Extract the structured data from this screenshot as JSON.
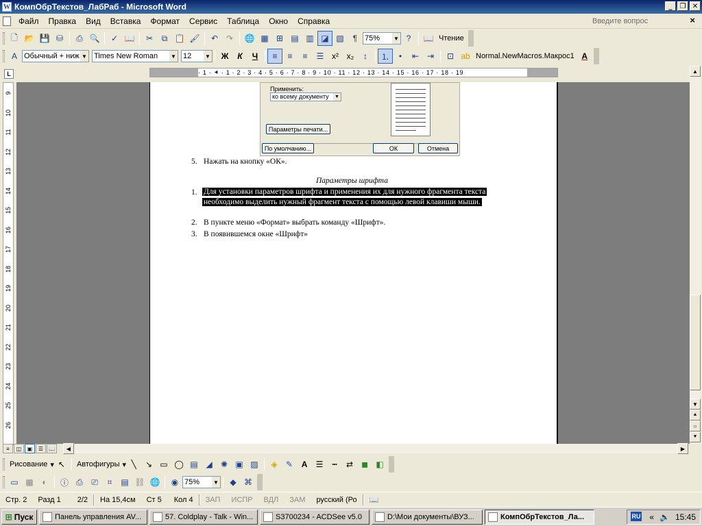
{
  "window": {
    "title": "КомпОбрТекстов_ЛабРаб - Microsoft Word"
  },
  "menu": {
    "items": [
      "Файл",
      "Правка",
      "Вид",
      "Вставка",
      "Формат",
      "Сервис",
      "Таблица",
      "Окно",
      "Справка"
    ],
    "ask_placeholder": "Введите вопрос"
  },
  "toolbar_standard": {
    "zoom": "75%",
    "read_label": "Чтение"
  },
  "toolbar_format": {
    "style": "Обычный + ниж",
    "font": "Times New Roman",
    "size": "12",
    "bold": "Ж",
    "italic": "К",
    "underline": "Ч",
    "macro": "Normal.NewMacros.Макрос1"
  },
  "ruler_marks": "· 1 · ⯇ · 1 · 2 · 3 · 4 · 5 · 6 · 7 · 8 · 9 · 10 · 11 · 12 · 13 · 14 · 15 · 16 · 17 · 18 · 19",
  "dialog": {
    "apply_label": "Применить:",
    "apply_value": "ко всему документу",
    "print_params": "Параметры печати...",
    "default": "По умолчанию...",
    "ok": "ОК",
    "cancel": "Отмена"
  },
  "document": {
    "step5_num": "5.",
    "step5": "Нажать на кнопку «ОК».",
    "heading": "Параметры шрифта",
    "item1_num": "1.",
    "item1_line1": "Для установки параметров шрифта и применения их для нужного фрагмента текста",
    "item1_line2": "необходимо выделить нужный фрагмент текста с помощью левой клавиши мыши.",
    "item2_num": "2.",
    "item2": "В пункте меню «Формат» выбрать команду «Шрифт».",
    "item3_num": "3.",
    "item3": "В появившемся окне «Шрифт»"
  },
  "toolbar_drawing": {
    "drawing": "Рисование",
    "autoshapes": "Автофигуры"
  },
  "toolbar_picture": {
    "zoom": "75%"
  },
  "status": {
    "page": "Стр. 2",
    "section": "Разд 1",
    "pages": "2/2",
    "at": "На 15,4см",
    "line": "Ст 5",
    "col": "Кол 4",
    "rec": "ЗАП",
    "trk": "ИСПР",
    "ext": "ВДЛ",
    "ovr": "ЗАМ",
    "lang": "русский (Ро"
  },
  "taskbar": {
    "start": "Пуск",
    "tasks": [
      "Панель управления AV...",
      "57. Coldplay - Talk - Win...",
      "S3700234 - ACDSee v5.0",
      "D:\\Мои документы\\ВУЗ...",
      "КомпОбрТекстов_Ла..."
    ],
    "lang": "RU",
    "time": "15:45"
  }
}
